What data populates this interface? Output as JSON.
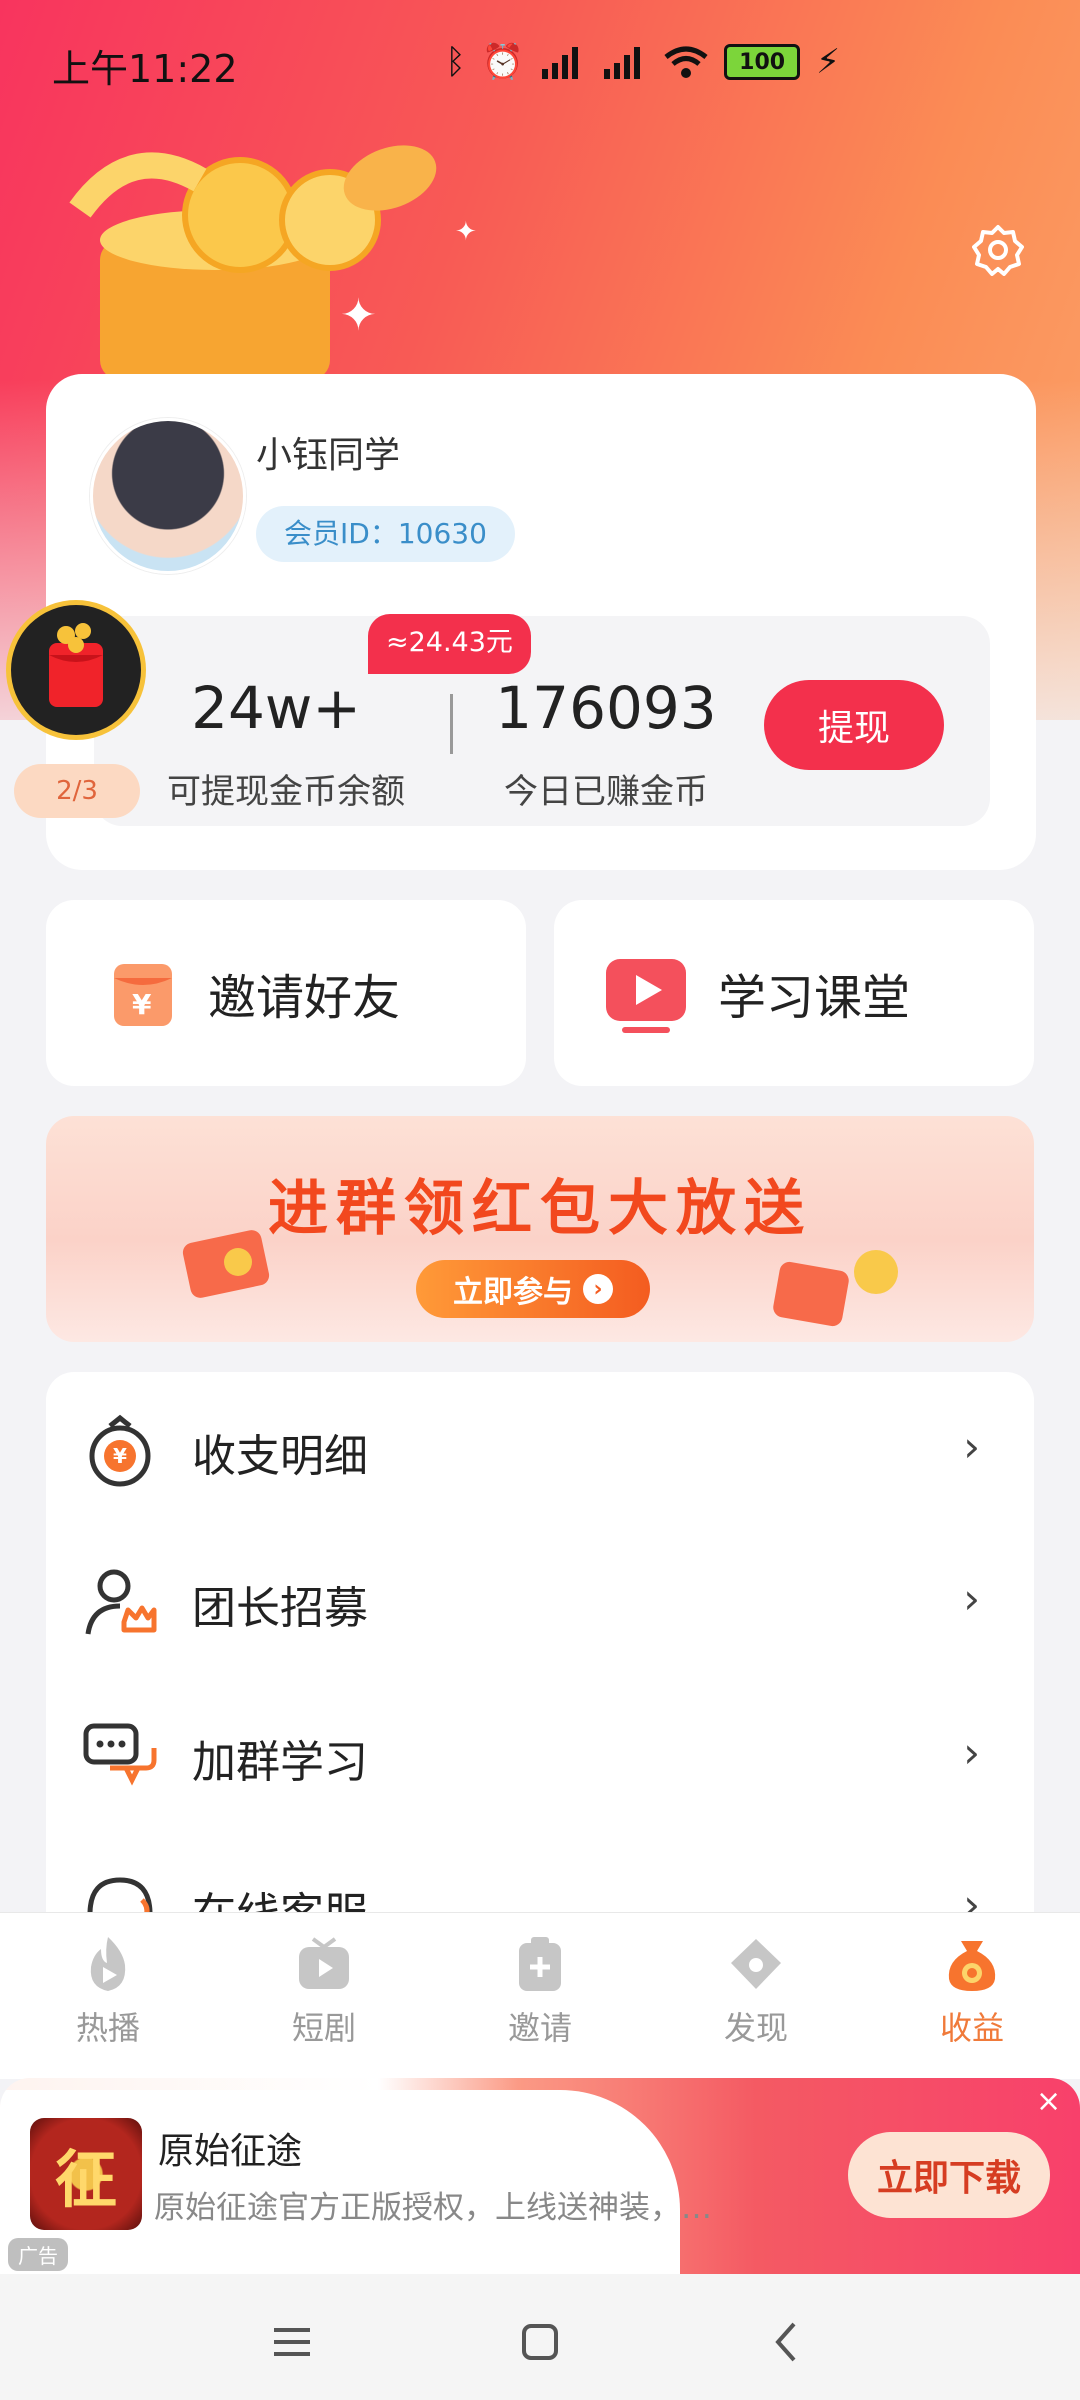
{
  "status_bar": {
    "time": "上午11:22",
    "battery": "100"
  },
  "profile": {
    "username": "小钰同学",
    "member_id": "会员ID：10630"
  },
  "balance": {
    "rmb_badge": "≈24.43元",
    "withdrawable_coins": "24w+",
    "withdrawable_label": "可提现金币余额",
    "today_coins": "176093",
    "today_label": "今日已赚金币",
    "withdraw_button": "提现"
  },
  "floating_redpacket": {
    "progress": "2/3"
  },
  "quick_actions": [
    {
      "label": "邀请好友",
      "icon": "invite-icon"
    },
    {
      "label": "学习课堂",
      "icon": "play-video-icon"
    }
  ],
  "banner": {
    "title": "进群领红包大放送",
    "button": "立即参与"
  },
  "menu": [
    {
      "label": "收支明细",
      "icon": "yuan-bag-icon"
    },
    {
      "label": "团长招募",
      "icon": "user-crown-icon"
    },
    {
      "label": "加群学习",
      "icon": "chat-bubbles-icon"
    },
    {
      "label": "在线客服",
      "icon": "headset-icon"
    }
  ],
  "bottom_nav": [
    {
      "label": "热播",
      "icon": "flame-play-icon"
    },
    {
      "label": "短剧",
      "icon": "tv-icon"
    },
    {
      "label": "邀请",
      "icon": "clipboard-plus-icon"
    },
    {
      "label": "发现",
      "icon": "house-icon"
    },
    {
      "label": "收益",
      "icon": "money-bag-icon",
      "active": true
    }
  ],
  "ad": {
    "title": "原始征途",
    "description": "原始征途官方正版授权，上线送神装，…",
    "thumb_text": "征",
    "tag": "广告",
    "download_button": "立即下载",
    "close": "×"
  },
  "colors": {
    "accent_red": "#f3304c",
    "active_nav": "#f07a3a",
    "header_gradient_start": "#f8345e",
    "header_gradient_end": "#fba168"
  }
}
